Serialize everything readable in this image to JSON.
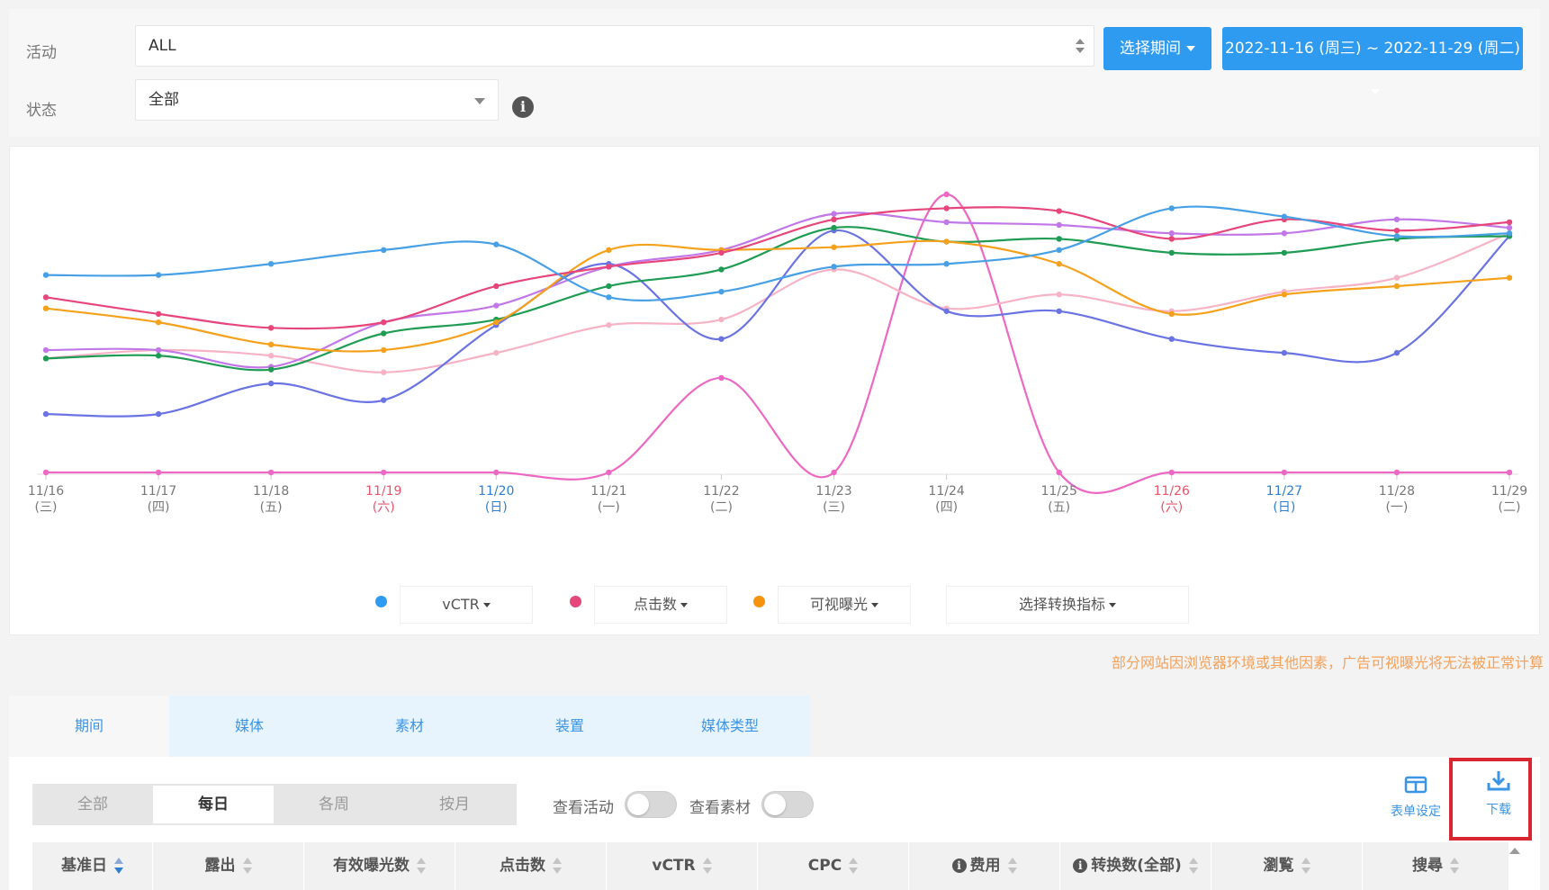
{
  "filters": {
    "campaign_label": "活动",
    "campaign_value": "ALL",
    "status_label": "状态",
    "status_value": "全部",
    "period_button": "选择期间",
    "date_range": "2022-11-16 (周三) ~ 2022-11-29 (周二)"
  },
  "chart_data": {
    "type": "line",
    "x": [
      "11/16",
      "11/17",
      "11/18",
      "11/19",
      "11/20",
      "11/21",
      "11/22",
      "11/23",
      "11/24",
      "11/25",
      "11/26",
      "11/27",
      "11/28",
      "11/29"
    ],
    "x_sub": [
      "(三)",
      "(四)",
      "(五)",
      "(六)",
      "(日)",
      "(一)",
      "(二)",
      "(三)",
      "(四)",
      "(五)",
      "(六)",
      "(日)",
      "(一)",
      "(二)"
    ],
    "x_day_type": [
      "",
      "",
      "",
      "sat",
      "sun",
      "",
      "",
      "",
      "",
      "",
      "sat",
      "sun",
      "",
      ""
    ],
    "ylim": [
      0,
      100
    ],
    "grid": false,
    "legend": "bottom-center",
    "series": [
      {
        "name": "vCTR",
        "color": "#47a0e6",
        "values": [
          71,
          71,
          75,
          80,
          82,
          63,
          65,
          74,
          75,
          80,
          95,
          92,
          85,
          86
        ]
      },
      {
        "name": "点击数",
        "color": "#e6467a",
        "values": [
          63,
          57,
          52,
          54,
          67,
          74,
          79,
          91,
          95,
          94,
          84,
          91,
          87,
          90
        ]
      },
      {
        "name": "可视曝光",
        "color": "#f5a11c",
        "values": [
          59,
          54,
          46,
          44,
          54,
          80,
          80,
          81,
          83,
          75,
          57,
          64,
          67,
          70
        ]
      },
      {
        "color": "#1f9c53",
        "values": [
          41,
          42,
          37,
          50,
          55,
          67,
          73,
          88,
          83,
          84,
          79,
          79,
          84,
          85
        ]
      },
      {
        "color": "#c277e8",
        "values": [
          44,
          44,
          38,
          54,
          60,
          74,
          80,
          93,
          90,
          89,
          86,
          86,
          91,
          88
        ]
      },
      {
        "color": "#6a73e3",
        "values": [
          21,
          21,
          32,
          26,
          53,
          75,
          48,
          87,
          58,
          58,
          48,
          43,
          43,
          85
        ]
      },
      {
        "color": "#f7b3c6",
        "values": [
          41,
          44,
          42,
          36,
          43,
          53,
          55,
          73,
          59,
          64,
          58,
          65,
          70,
          86
        ]
      },
      {
        "color": "#ed68c3",
        "values": [
          0,
          0,
          0,
          0,
          0,
          0,
          34,
          0,
          100,
          0,
          0,
          0,
          0,
          0
        ]
      }
    ]
  },
  "legend": {
    "metric1": "vCTR",
    "metric2": "点击数",
    "metric3": "可视曝光",
    "conversion": "选择转换指标",
    "colors": [
      "#2e9bf0",
      "#e6467a",
      "#f5930c"
    ]
  },
  "warning": "部分网站因浏览器环境或其他因素，广告可视曝光将无法被正常计算",
  "tabs": [
    "期间",
    "媒体",
    "素材",
    "装置",
    "媒体类型"
  ],
  "granularity": [
    "全部",
    "每日",
    "各周",
    "按月"
  ],
  "toggles": {
    "campaign": "查看活动",
    "creative": "查看素材"
  },
  "tools": {
    "table_settings": "表单设定",
    "download": "下载"
  },
  "table": {
    "columns": [
      "基准日",
      "露出",
      "有效曝光数",
      "点击数",
      "vCTR",
      "CPC",
      "费用",
      "转换数(全部)",
      "瀏覧",
      "搜尋"
    ]
  }
}
